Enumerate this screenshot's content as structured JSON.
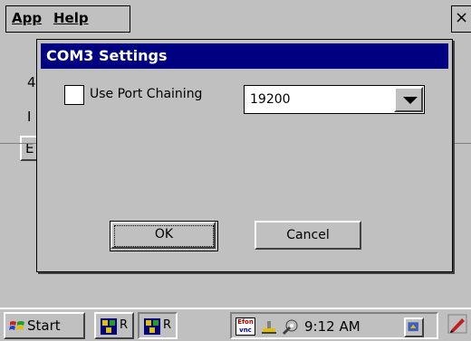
{
  "menubar": {
    "app": "App",
    "help": "Help",
    "close": "×"
  },
  "background": {
    "fragment_1": "4",
    "fragment_2": "I",
    "fragment_3": "E"
  },
  "dialog": {
    "title": "COM3 Settings",
    "chain_label": "Use Port Chaining",
    "chain_checked": false,
    "baud_value": "19200",
    "ok_label": "OK",
    "cancel_label": "Cancel"
  },
  "taskbar": {
    "start_label": "Start",
    "task_1_label": "R",
    "task_2_label": "R",
    "vnc_top": "Efon",
    "vnc_bottom": "vnc",
    "clock": "9:12 AM"
  },
  "colors": {
    "title_bar": "#000080",
    "face": "#c0c0c0"
  },
  "icons": [
    "windows-flag-icon",
    "app-cubes-icon",
    "vnc-icon",
    "network-icon",
    "wrench-icon",
    "desktop-icon",
    "pen-icon",
    "chevron-down-icon"
  ]
}
